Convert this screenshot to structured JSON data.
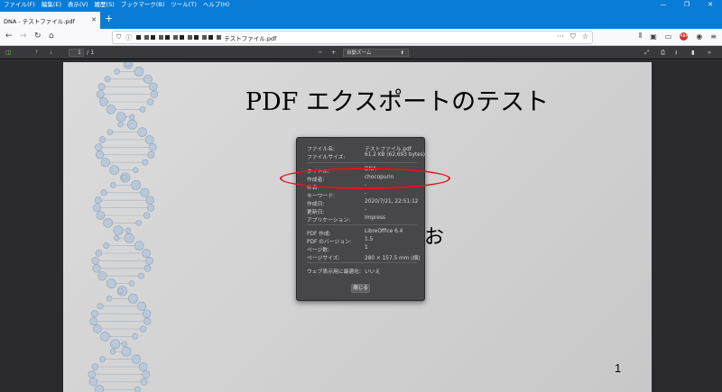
{
  "window": {
    "menu": [
      "ファイル(F)",
      "編集(E)",
      "表示(V)",
      "履歴(S)",
      "ブックマーク(B)",
      "ツール(T)",
      "ヘルプ(H)"
    ],
    "controls": [
      "—",
      "❐",
      "✕"
    ]
  },
  "tab": {
    "title": "DNA - テストファイル.pdf",
    "close": "✕",
    "new_tab": "+"
  },
  "urlbar": {
    "url_visible_suffix": "テストファイル.pdf"
  },
  "pdf_toolbar": {
    "page_current": "1",
    "page_total": "/ 1",
    "zoom_minus": "−",
    "zoom_plus": "+",
    "zoom_value": "自動ズーム"
  },
  "page": {
    "title": "PDF エクスポートのテスト",
    "subtitle_visible": "お",
    "number": "1"
  },
  "properties": {
    "rows_file": [
      {
        "label": "ファイル名:",
        "value": "テストファイル.pdf"
      },
      {
        "label": "ファイルサイズ:",
        "value": "61.2 KB (62,693 bytes)"
      }
    ],
    "rows_doc": [
      {
        "label": "タイトル:",
        "value": "DNA"
      },
      {
        "label": "作成者:",
        "value": "chocopurin"
      },
      {
        "label": "件名:",
        "value": "-"
      },
      {
        "label": "キーワード:",
        "value": "-"
      },
      {
        "label": "作成日:",
        "value": "2020/7/21, 22:51:12"
      },
      {
        "label": "更新日:",
        "value": "-"
      },
      {
        "label": "アプリケーション:",
        "value": "Impress"
      }
    ],
    "rows_pdf": [
      {
        "label": "PDF 作成:",
        "value": "LibreOffice 6.4"
      },
      {
        "label": "PDF のバージョン:",
        "value": "1.5"
      },
      {
        "label": "ページ数:",
        "value": "1"
      },
      {
        "label": "ページサイズ:",
        "value": "280 × 157.5 mm (横)"
      }
    ],
    "rows_web": [
      {
        "label": "ウェブ表示用に最適化:",
        "value": "いいえ"
      }
    ],
    "close_label": "閉じる"
  },
  "annotation": {
    "color": "#e0141f"
  }
}
